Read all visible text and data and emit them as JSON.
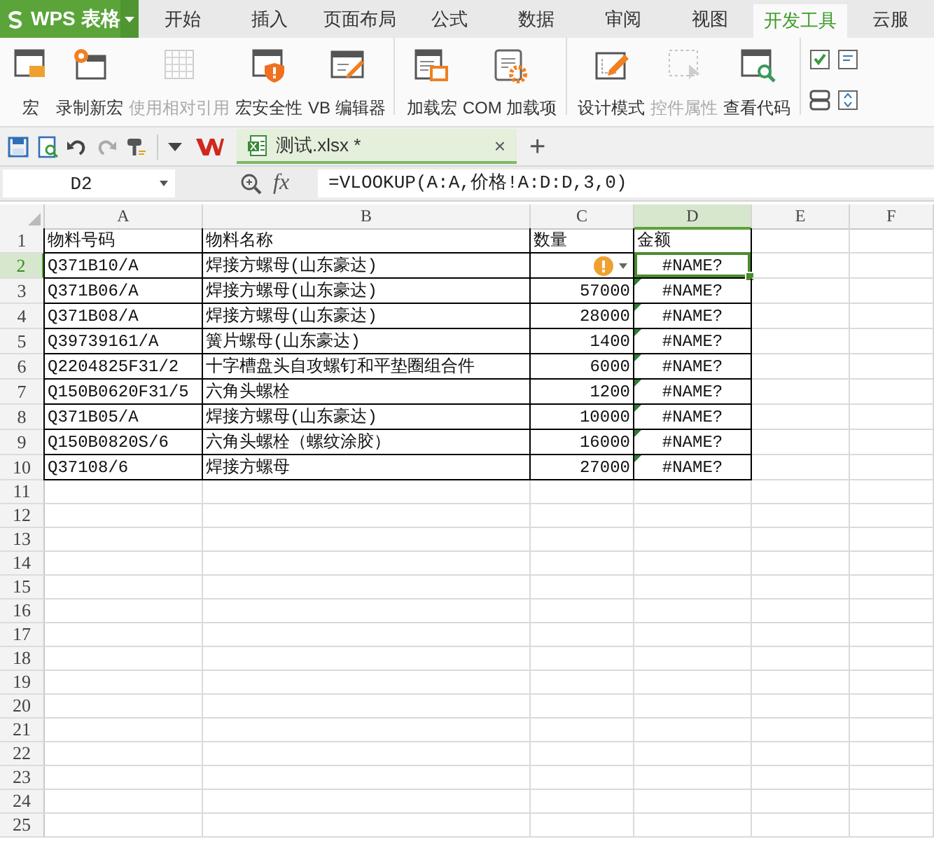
{
  "app": {
    "logo": "WPS 表格"
  },
  "menu_tabs": [
    {
      "label": "开始",
      "selected": false
    },
    {
      "label": "插入",
      "selected": false
    },
    {
      "label": "页面布局",
      "selected": false
    },
    {
      "label": "公式",
      "selected": false
    },
    {
      "label": "数据",
      "selected": false
    },
    {
      "label": "审阅",
      "selected": false
    },
    {
      "label": "视图",
      "selected": false
    },
    {
      "label": "开发工具",
      "selected": true
    },
    {
      "label": "云服",
      "selected": false
    }
  ],
  "ribbon_groups": [
    {
      "buttons": [
        {
          "label": "宏",
          "disabled": false
        },
        {
          "label": "录制新宏",
          "disabled": false
        },
        {
          "label": "使用相对引用",
          "disabled": true
        },
        {
          "label": "宏安全性",
          "disabled": false
        },
        {
          "label": "VB 编辑器",
          "disabled": false
        }
      ]
    },
    {
      "buttons": [
        {
          "label": "加载宏",
          "disabled": false
        },
        {
          "label": "COM 加载项",
          "disabled": false
        }
      ]
    },
    {
      "buttons": [
        {
          "label": "设计模式",
          "disabled": false
        },
        {
          "label": "控件属性",
          "disabled": true
        },
        {
          "label": "查看代码",
          "disabled": false
        }
      ]
    }
  ],
  "quick_access_tools": [
    {
      "disabled": false
    },
    {
      "disabled": false
    },
    {
      "disabled": false
    },
    {
      "disabled": true
    },
    {
      "disabled": false
    }
  ],
  "document_tabs": [
    {
      "title": "测试.xlsx *",
      "selected": true,
      "close": "×"
    }
  ],
  "new_tab": "+",
  "formula_bar": {
    "name_box": "D2",
    "fx": "fx",
    "formula": "=VLOOKUP(A:A,价格!A:D:D,3,0)"
  },
  "sheet": {
    "columns": [
      {
        "label": "A",
        "selected": false
      },
      {
        "label": "B",
        "selected": false
      },
      {
        "label": "C",
        "selected": false
      },
      {
        "label": "D",
        "selected": true
      },
      {
        "label": "E",
        "selected": false
      },
      {
        "label": "F",
        "selected": false
      }
    ],
    "rows": [
      {
        "number": "1",
        "selected": false,
        "cells": [
          "物料号码",
          "物料名称",
          "数量",
          "金额"
        ]
      },
      {
        "number": "2",
        "selected": true,
        "warning": true,
        "cells": [
          "Q371B10/A",
          "焊接方螺母(山东豪达)",
          null,
          "#NAME?"
        ]
      },
      {
        "number": "3",
        "selected": false,
        "flagged": true,
        "cells": [
          "Q371B06/A",
          "焊接方螺母(山东豪达)",
          "57000",
          "#NAME?"
        ]
      },
      {
        "number": "4",
        "selected": false,
        "flagged": true,
        "cells": [
          "Q371B08/A",
          "焊接方螺母(山东豪达)",
          "28000",
          "#NAME?"
        ]
      },
      {
        "number": "5",
        "selected": false,
        "flagged": true,
        "cells": [
          "Q39739161/A",
          "簧片螺母(山东豪达)",
          "1400",
          "#NAME?"
        ]
      },
      {
        "number": "6",
        "selected": false,
        "flagged": true,
        "cells": [
          "Q2204825F31/2",
          "十字槽盘头自攻螺钉和平垫圈组合件",
          "6000",
          "#NAME?"
        ]
      },
      {
        "number": "7",
        "selected": false,
        "flagged": true,
        "cells": [
          "Q150B0620F31/5",
          "六角头螺栓",
          "1200",
          "#NAME?"
        ]
      },
      {
        "number": "8",
        "selected": false,
        "flagged": true,
        "cells": [
          "Q371B05/A",
          "焊接方螺母(山东豪达)",
          "10000",
          "#NAME?"
        ]
      },
      {
        "number": "9",
        "selected": false,
        "flagged": true,
        "cells": [
          "Q150B0820S/6",
          "六角头螺栓（螺纹涂胶）",
          "16000",
          "#NAME?"
        ]
      },
      {
        "number": "10",
        "selected": false,
        "flagged": true,
        "cells": [
          "Q37108/6",
          "焊接方螺母",
          "27000",
          "#NAME?"
        ]
      },
      {
        "number": "11",
        "selected": false
      },
      {
        "number": "12",
        "selected": false
      },
      {
        "number": "13",
        "selected": false
      },
      {
        "number": "14",
        "selected": false
      },
      {
        "number": "15",
        "selected": false
      },
      {
        "number": "16",
        "selected": false
      },
      {
        "number": "17",
        "selected": false
      },
      {
        "number": "18",
        "selected": false
      },
      {
        "number": "19",
        "selected": false
      },
      {
        "number": "20",
        "selected": false
      },
      {
        "number": "21",
        "selected": false
      },
      {
        "number": "22",
        "selected": false
      },
      {
        "number": "23",
        "selected": false
      },
      {
        "number": "24",
        "selected": false
      },
      {
        "number": "25",
        "selected": false
      }
    ]
  }
}
